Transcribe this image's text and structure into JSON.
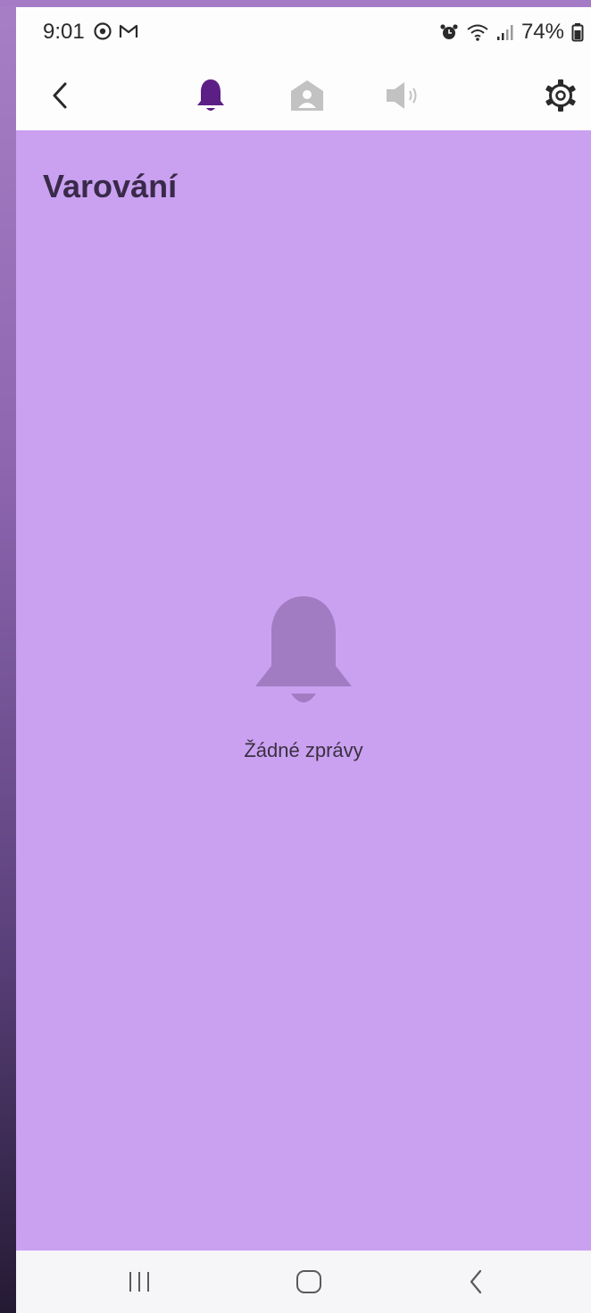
{
  "status_bar": {
    "time": "9:01",
    "battery": "74%",
    "app_icons": [
      "sync-icon",
      "gmail-icon"
    ],
    "system_icons": [
      "alarm-icon",
      "wifi-icon",
      "signal-icon",
      "battery-icon"
    ]
  },
  "toolbar": {
    "icons": [
      "back-icon",
      "bell-icon",
      "contact-icon",
      "speaker-icon",
      "settings-icon"
    ],
    "active_color": "#5b1f86",
    "inactive_color": "#c2c2c2"
  },
  "main": {
    "title": "Varování",
    "empty_text": "Žádné zprávy",
    "background": "#caa1f1"
  },
  "nav_bar": {
    "icons": [
      "recent-apps-icon",
      "home-icon",
      "back-nav-icon"
    ]
  }
}
